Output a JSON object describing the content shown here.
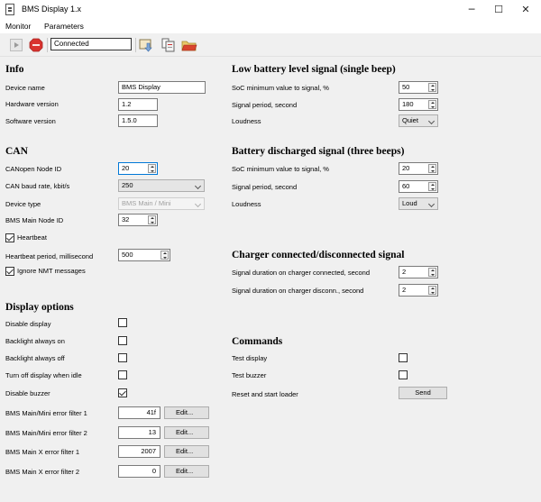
{
  "window": {
    "title": "BMS Display 1.x",
    "minimize_glyph": "─",
    "maximize_glyph": "☐",
    "close_glyph": "✕"
  },
  "menu": [
    "Monitor",
    "Parameters"
  ],
  "toolbar": {
    "status": "Connected",
    "icons": [
      "play-icon",
      "stop-icon",
      "download-to-device-icon",
      "upload-from-device-icon",
      "open-folder-icon"
    ],
    "stop_color": "#d9332f"
  },
  "info": {
    "title": "Info",
    "device_name_label": "Device name",
    "device_name": "BMS Display",
    "hardware_version_label": "Hardware version",
    "hardware_version": "1.2",
    "software_version_label": "Software version",
    "software_version": "1.5.0"
  },
  "can": {
    "title": "CAN",
    "node_id_label": "CANopen Node ID",
    "node_id": "20",
    "baud_rate_label": "CAN baud rate, kbit/s",
    "baud_rate": "250",
    "device_type_label": "Device type",
    "device_type": "BMS Main / Mini",
    "bms_main_node_id_label": "BMS Main Node ID",
    "bms_main_node_id": "32",
    "heartbeat_label": "Heartbeat",
    "heartbeat": true,
    "heartbeat_period_label": "Heartbeat period, millisecond",
    "heartbeat_period": "500",
    "ignore_nmt_label": "Ignore NMT messages",
    "ignore_nmt": true
  },
  "display": {
    "title": "Display options",
    "disable_display_label": "Disable display",
    "backlight_on_label": "Backlight always on",
    "backlight_off_label": "Backlight always off",
    "turn_off_idle_label": "Turn off display when idle",
    "disable_buzzer_label": "Disable buzzer",
    "disable_buzzer": true,
    "filter1_label": "BMS Main/Mini error filter 1",
    "filter1": "41f",
    "filter2_label": "BMS Main/Mini error filter 2",
    "filter2": "13",
    "x_filter1_label": "BMS Main X error filter 1",
    "x_filter1": "2007",
    "x_filter2_label": "BMS Main X error filter 2",
    "x_filter2": "0",
    "edit_label": "Edit..."
  },
  "low_battery": {
    "title": "Low battery level signal (single beep)",
    "soc_label": "SoC minimum value to signal, %",
    "soc": "50",
    "period_label": "Signal period, second",
    "period": "180",
    "loudness_label": "Loudness",
    "loudness": "Quiet"
  },
  "discharged": {
    "title": "Battery discharged signal (three beeps)",
    "soc_label": "SoC minimum value to signal, %",
    "soc": "20",
    "period_label": "Signal period, second",
    "period": "60",
    "loudness_label": "Loudness",
    "loudness": "Loud"
  },
  "charger": {
    "title": "Charger connected/disconnected signal",
    "connected_label": "Signal duration on charger connected, second",
    "connected": "2",
    "disconnected_label": "Signal duration on charger disconn., second",
    "disconnected": "2"
  },
  "commands": {
    "title": "Commands",
    "test_display_label": "Test display",
    "test_buzzer_label": "Test buzzer",
    "reset_label": "Reset and start loader",
    "send_label": "Send"
  }
}
